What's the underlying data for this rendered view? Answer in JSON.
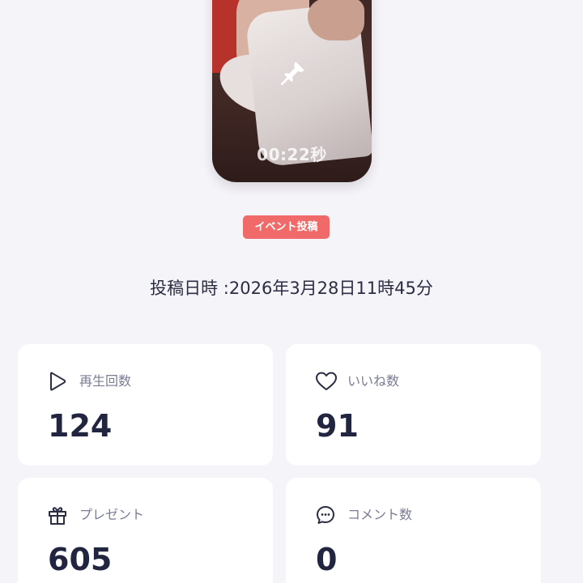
{
  "video": {
    "duration": "00:22秒",
    "pin_icon": "pin-icon"
  },
  "badge": {
    "label": "イベント投稿",
    "color": "#ef6a69"
  },
  "post": {
    "datetime": "投稿日時 :2026年3月28日11時45分"
  },
  "stats": [
    {
      "label": "再生回数",
      "value": "124",
      "icon": "play-icon"
    },
    {
      "label": "いいね数",
      "value": "91",
      "icon": "heart-icon"
    },
    {
      "label": "プレゼント",
      "value": "605",
      "icon": "gift-icon"
    },
    {
      "label": "コメント数",
      "value": "0",
      "icon": "comment-icon"
    }
  ]
}
